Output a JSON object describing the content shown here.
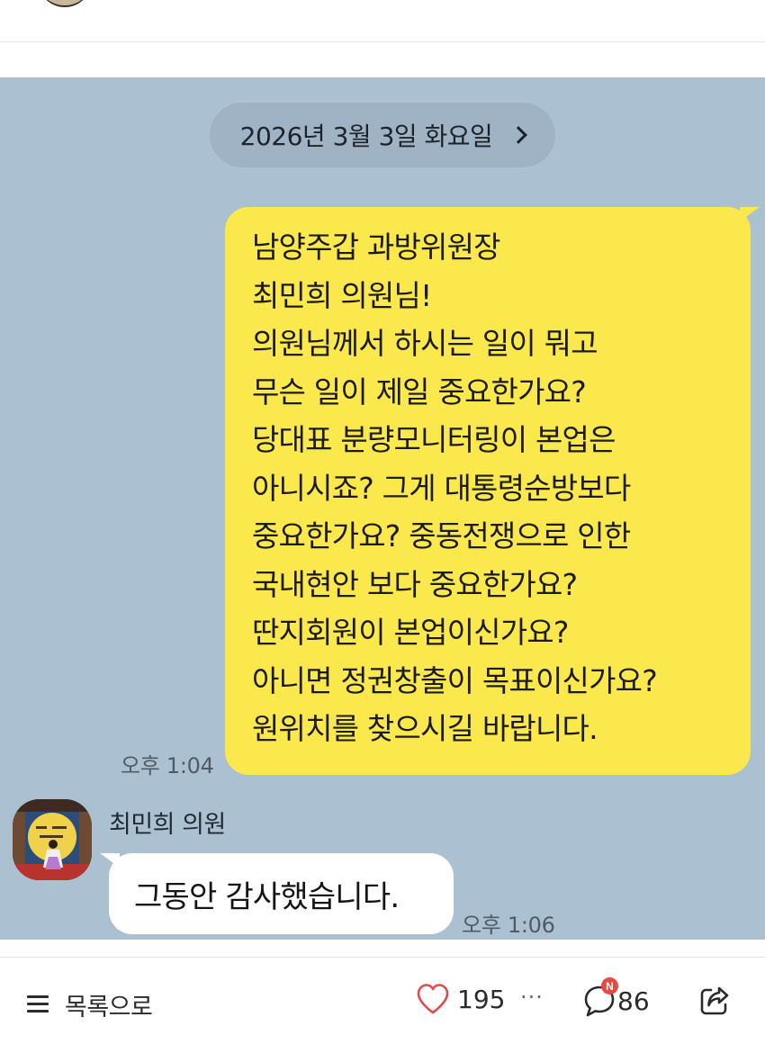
{
  "chat": {
    "date_divider": "2026년 3월 3일 화요일",
    "messages": [
      {
        "from": "me",
        "lines": [
          "남양주갑 과방위원장",
          "최민희 의원님!",
          "의원님께서 하시는 일이 뭐고",
          "무슨 일이 제일 중요한가요?",
          "당대표 분량모니터링이 본업은",
          "아니시죠? 그게 대통령순방보다",
          "중요한가요? 중동전쟁으로 인한",
          "국내현안 보다 중요한가요?",
          "딴지회원이 본업이신가요?",
          "아니면 정권창출이 목표이신가요?",
          "원위치를 찾으시길 바랍니다."
        ],
        "time": "오후 1:04"
      },
      {
        "from": "them",
        "sender": "최민희 의원",
        "text": "그동안 감사했습니다.",
        "time": "오후 1:06"
      }
    ]
  },
  "bottom_bar": {
    "list_label": "목록으로",
    "like_count": "195",
    "more_label": "···",
    "comment_badge": "N",
    "comment_count": "86"
  },
  "colors": {
    "chat_background": "#abc1d1",
    "my_bubble": "#fae84c",
    "their_bubble": "#ffffff",
    "like_heart": "#e5484d",
    "new_badge": "#e8483f"
  },
  "icons": {
    "list": "hamburger-icon",
    "like": "heart-icon",
    "comment": "comment-icon",
    "share": "share-icon",
    "date_nav": "chevron-right-icon"
  }
}
